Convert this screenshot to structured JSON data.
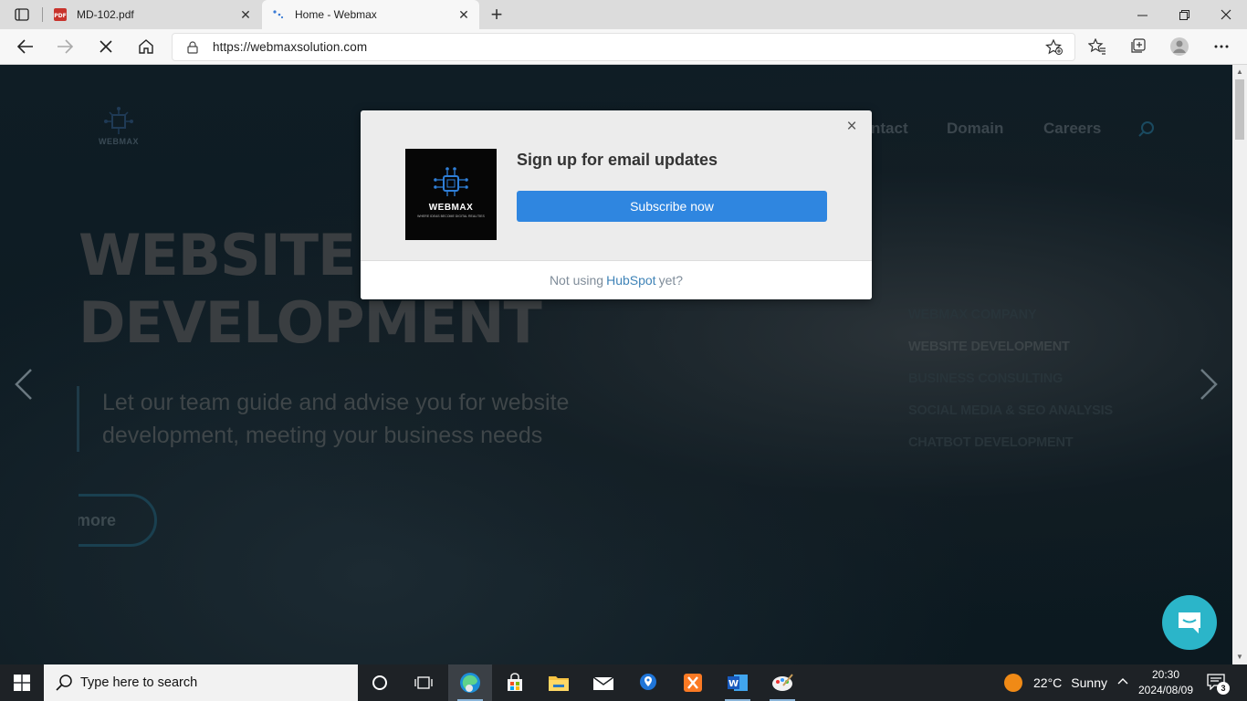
{
  "browser": {
    "tabs": [
      {
        "title": "MD-102.pdf",
        "icon": "pdf-icon"
      },
      {
        "title": "Home - Webmax",
        "icon": "webmax-favicon-icon"
      }
    ],
    "url": "https://webmaxsolution.com"
  },
  "site": {
    "logo_text": "WEBMAX",
    "nav": [
      "ntact",
      "Domain",
      "Careers"
    ],
    "hero_title_line1": "WEBSITE",
    "hero_title_line2": "DEVELOPMENT",
    "hero_subtitle": "Let our team guide and advise you for website development, meeting your business needs",
    "more_button": "more",
    "side_items": [
      "WEBMAX COMPANY",
      "WEBSITE DEVELOPMENT",
      "BUSINESS CONSULTING",
      "SOCIAL MEDIA & SEO ANALYSIS",
      "CHATBOT DEVELOPMENT"
    ],
    "active_side_item": 1
  },
  "modal": {
    "heading": "Sign up for email updates",
    "subscribe_label": "Subscribe now",
    "footer_prefix": "Not using",
    "footer_link": "HubSpot",
    "footer_suffix": "yet?",
    "logo_name": "WEBMAX",
    "logo_tagline": "WHERE IDEAS BECOME DIGITAL REALITIES",
    "close_glyph": "×"
  },
  "taskbar": {
    "search_placeholder": "Type here to search",
    "weather_temp": "22°C",
    "weather_condition": "Sunny",
    "time": "20:30",
    "date": "2024/08/09",
    "notification_count": "3",
    "pinned": [
      "task-view-icon",
      "edge-icon",
      "store-icon",
      "file-explorer-icon",
      "mail-icon",
      "maps-icon",
      "xampp-icon",
      "word-icon",
      "paint-icon"
    ]
  },
  "colors": {
    "accent_blue": "#2f86e0",
    "chat_teal": "#2bb5c9",
    "hubspot_link": "#3f83b7"
  }
}
